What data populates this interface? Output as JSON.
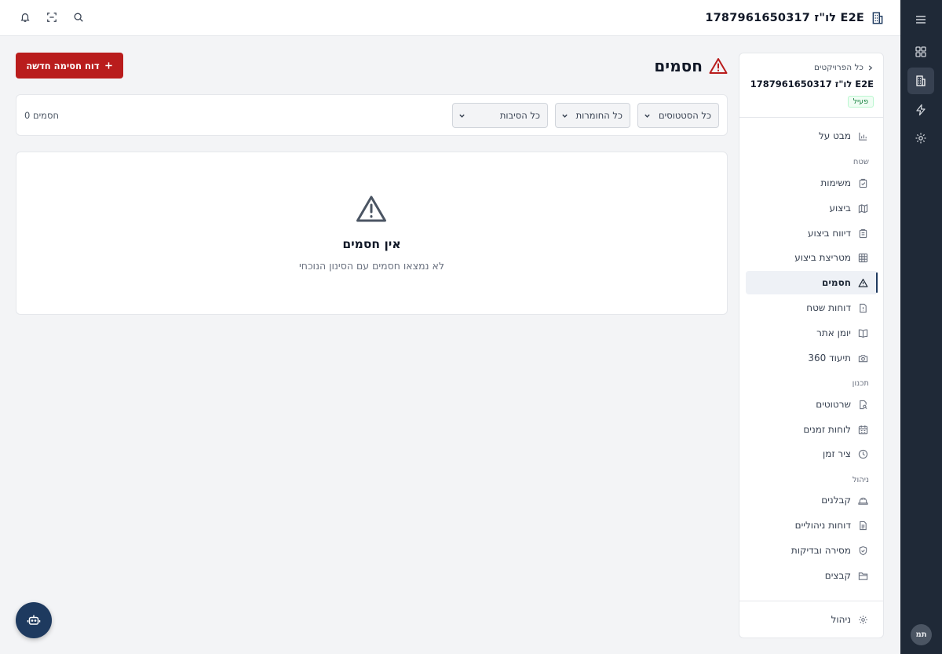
{
  "header": {
    "title": "E2E לו\"ז 1787961650317",
    "icons": [
      "building-icon",
      "search-icon",
      "scan-icon",
      "bell-icon"
    ]
  },
  "rail": {
    "items": [
      "menu-icon",
      "grid-icon",
      "building-icon",
      "lightning-icon",
      "gear-icon"
    ],
    "avatar": "תמ"
  },
  "sidebar": {
    "back_label": "כל הפרויקטים",
    "project_name": "E2E לו\"ז 1787961650317",
    "status_badge": "פעיל",
    "items": [
      {
        "label": "מבט על",
        "icon": "chart-icon"
      },
      {
        "label": "משימות",
        "icon": "clipboard-icon"
      },
      {
        "label": "ביצוע",
        "icon": "map-icon"
      },
      {
        "label": "דיווח ביצוע",
        "icon": "clipboard-list-icon"
      },
      {
        "label": "מטריצת ביצוע",
        "icon": "table-icon"
      },
      {
        "label": "חסמים",
        "icon": "warning-icon",
        "active": true
      },
      {
        "label": "דוחות שטח",
        "icon": "file-alert-icon"
      },
      {
        "label": "יומן אתר",
        "icon": "book-icon"
      },
      {
        "label": "תיעוד 360",
        "icon": "camera-icon"
      },
      {
        "label": "שרטוטים",
        "icon": "file-search-icon"
      },
      {
        "label": "לוחות זמנים",
        "icon": "calendar-icon"
      },
      {
        "label": "ציר זמן",
        "icon": "clock-icon"
      },
      {
        "label": "קבלנים",
        "icon": "hard-hat-icon"
      },
      {
        "label": "דוחות ניהוליים",
        "icon": "file-text-icon"
      },
      {
        "label": "מסירה ובדיקות",
        "icon": "shield-icon"
      },
      {
        "label": "קבצים",
        "icon": "folder-icon"
      }
    ],
    "sections": [
      "שטח",
      "תכנון",
      "ניהול"
    ],
    "footer_item": {
      "label": "ניהול",
      "icon": "gear-icon"
    }
  },
  "page": {
    "title": "חסמים",
    "new_button": "דוח חסימה חדשה"
  },
  "filters": {
    "status": "כל הסטטוסים",
    "severity": "כל החומרות",
    "reason": "כל הסיבות",
    "count": "0 חסמים"
  },
  "empty_state": {
    "title": "אין חסמים",
    "subtitle": "לא נמצאו חסמים עם הסינון הנוכחי"
  },
  "colors": {
    "accent_red": "#b91c1c",
    "rail_dark": "#1f2937",
    "fab_navy": "#1e3a5f",
    "active_green": "#15803d"
  }
}
